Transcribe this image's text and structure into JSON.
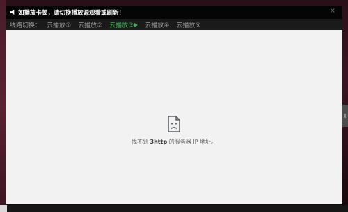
{
  "notice": {
    "text": "如播放卡顿，请切换播放源观看或刷新！",
    "icon": "speaker-icon"
  },
  "close": {
    "label": "×",
    "icon": "close-icon"
  },
  "lines": {
    "label": "线路切换：",
    "tabs": [
      {
        "label": "云播放①",
        "active": false
      },
      {
        "label": "云播放②",
        "active": false
      },
      {
        "label": "云播放③",
        "active": true
      },
      {
        "label": "云播放④",
        "active": false
      },
      {
        "label": "云播放⑤",
        "active": false
      }
    ],
    "active_color": "#36b24a"
  },
  "error": {
    "prefix": "找不到 ",
    "host": "3http",
    "suffix": " 的服务器 IP 地址。",
    "icon": "sad-page-icon"
  }
}
